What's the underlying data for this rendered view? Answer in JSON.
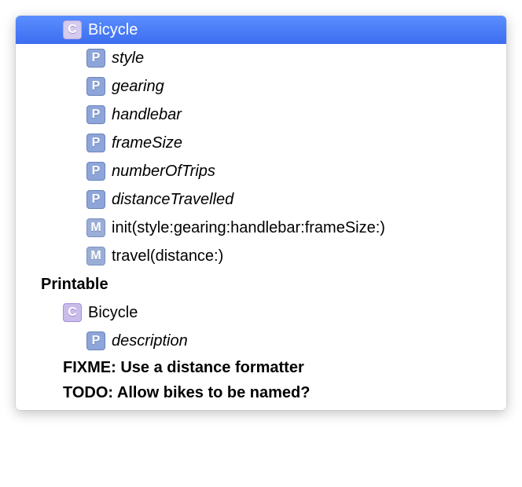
{
  "main_class": {
    "kind": "C",
    "name": "Bicycle",
    "selected": true,
    "members": [
      {
        "kind": "P",
        "name": "style",
        "italic": true
      },
      {
        "kind": "P",
        "name": "gearing",
        "italic": true
      },
      {
        "kind": "P",
        "name": "handlebar",
        "italic": true
      },
      {
        "kind": "P",
        "name": "frameSize",
        "italic": true
      },
      {
        "kind": "P",
        "name": "numberOfTrips",
        "italic": true
      },
      {
        "kind": "P",
        "name": "distanceTravelled",
        "italic": true
      },
      {
        "kind": "M",
        "name": "init(style:gearing:handlebar:frameSize:)",
        "italic": false
      },
      {
        "kind": "M",
        "name": "travel(distance:)",
        "italic": false
      }
    ]
  },
  "protocol_section": {
    "heading": "Printable",
    "class": {
      "kind": "C",
      "name": "Bicycle"
    },
    "members": [
      {
        "kind": "P",
        "name": "description",
        "italic": true
      }
    ]
  },
  "notes": [
    "FIXME: Use a distance formatter",
    "TODO: Allow bikes to be named?"
  ]
}
